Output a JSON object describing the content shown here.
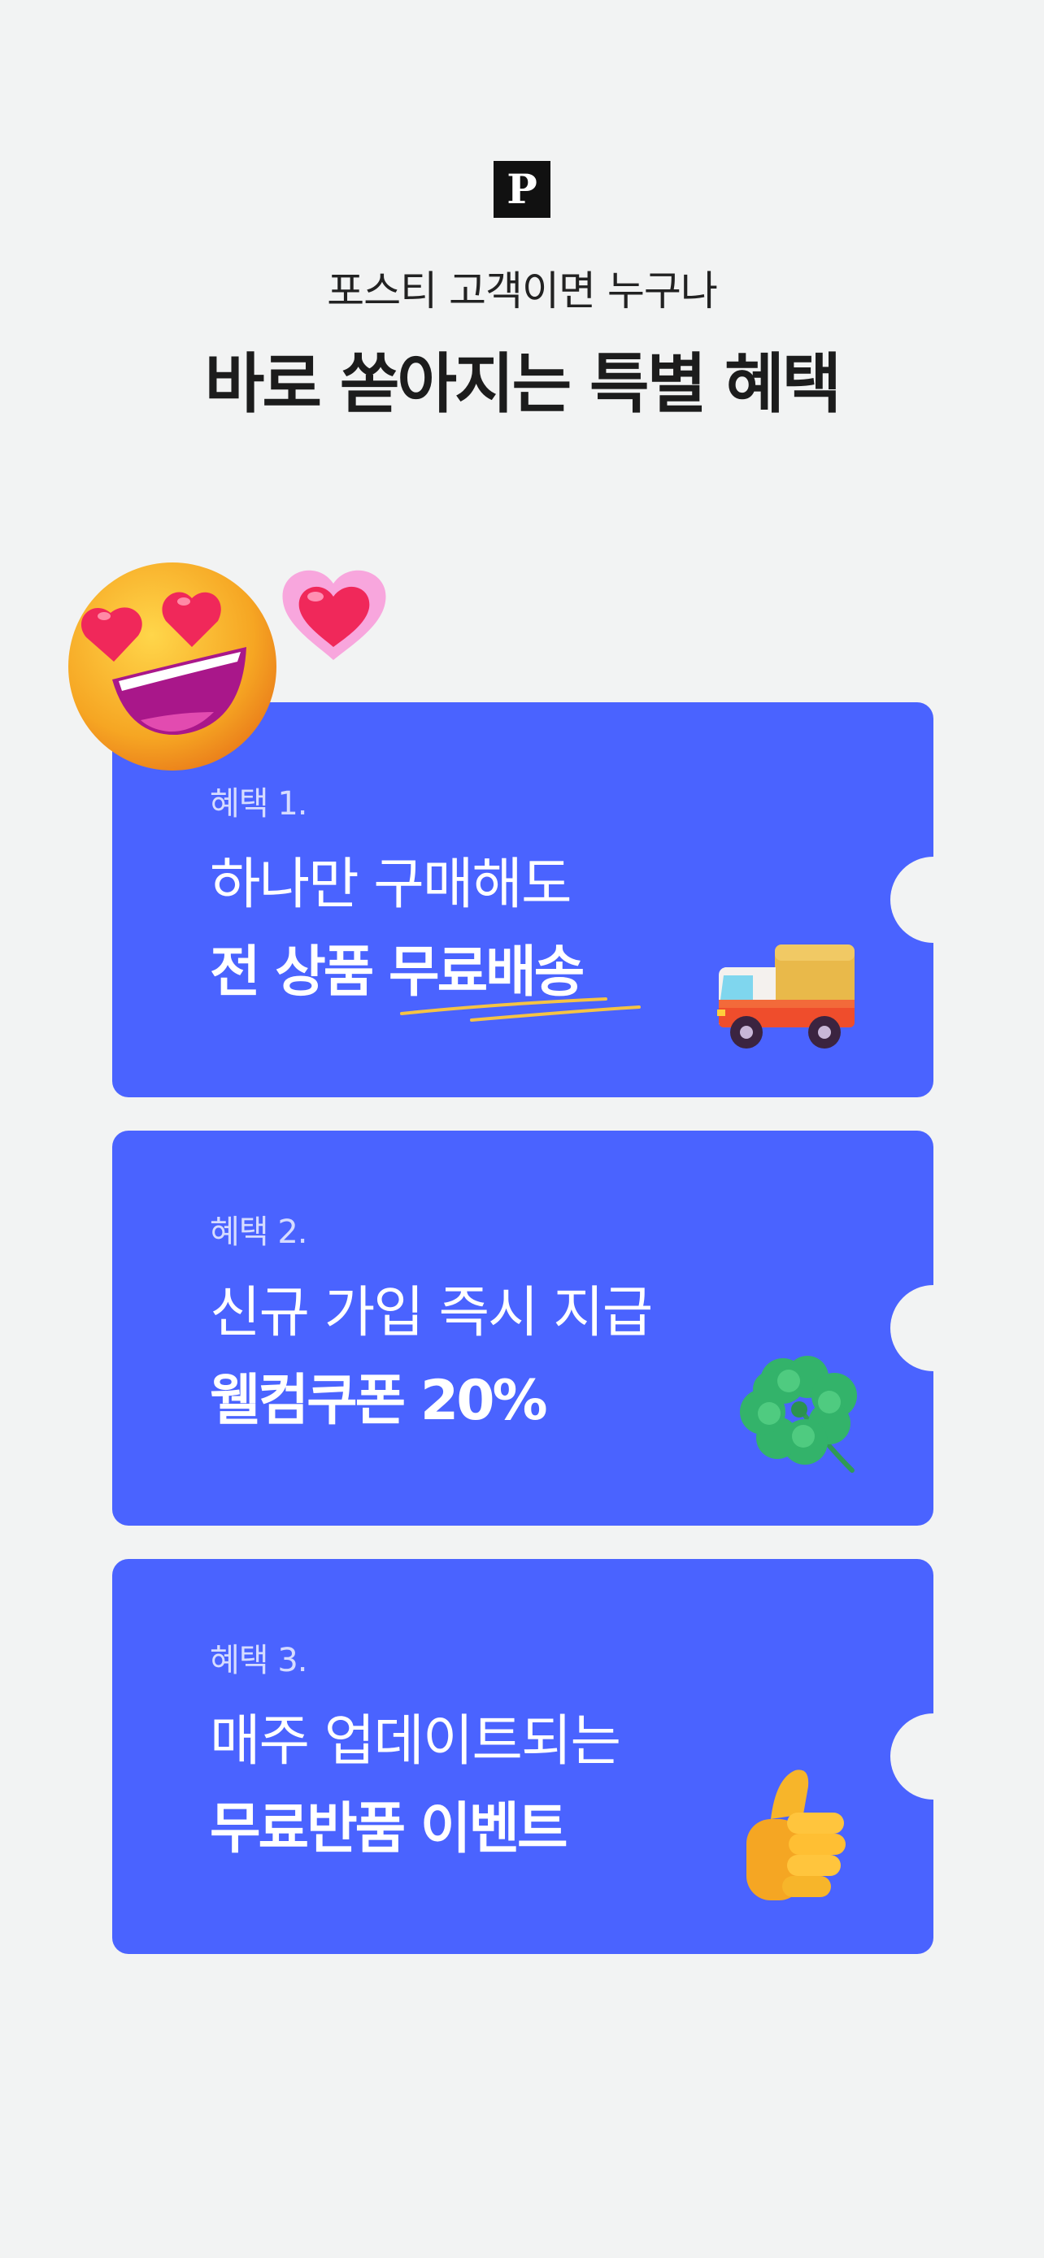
{
  "header": {
    "logo_letter": "P",
    "subtitle": "포스티 고객이면 누구나",
    "title": "바로 쏟아지는 특별 혜택"
  },
  "benefits": [
    {
      "tag": "혜택 1.",
      "line1": "하나만 구매해도",
      "line2": "전 상품 무료배송",
      "icon": "delivery-truck-icon"
    },
    {
      "tag": "혜택 2.",
      "line1": "신규 가입 즉시 지급",
      "line2": "웰컴쿠폰 20%",
      "icon": "four-leaf-clover-icon"
    },
    {
      "tag": "혜택 3.",
      "line1": "매주 업데이트되는",
      "line2": "무료반품 이벤트",
      "icon": "thumbs-up-icon"
    }
  ],
  "decorations": {
    "face": "heart-eyes-face-icon",
    "heart": "pink-heart-icon"
  },
  "colors": {
    "background": "#f2f3f3",
    "card": "#4a63ff",
    "accent_underline": "#f5c344"
  }
}
